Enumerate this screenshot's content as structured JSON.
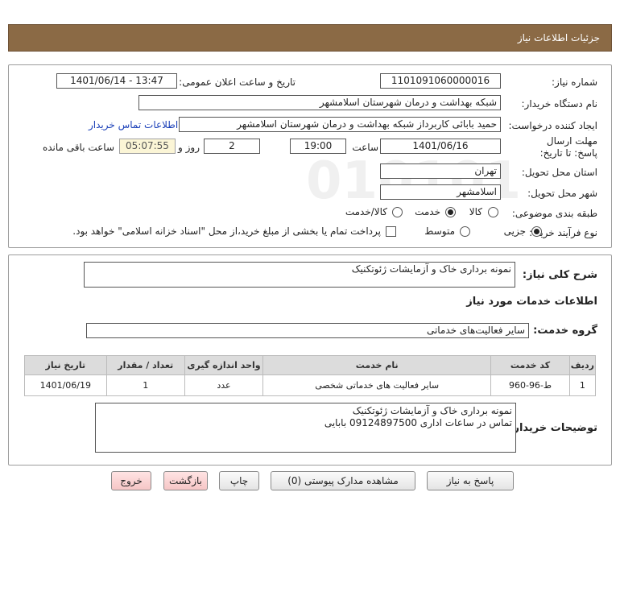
{
  "header": {
    "title": "جزئیات اطلاعات نیاز"
  },
  "form": {
    "need_number_label": "شماره نیاز:",
    "need_number": "1101091060000016",
    "announce_label": "تاریخ و ساعت اعلان عمومی:",
    "announce_value": "1401/06/14 - 13:47",
    "buyer_org_label": "نام دستگاه خریدار:",
    "buyer_org": "شبکه بهداشت و درمان شهرستان اسلامشهر",
    "creator_label": "ایجاد کننده درخواست:",
    "creator": "حمید بابائی کاربرداز شبکه بهداشت و درمان شهرستان اسلامشهر",
    "contact_link": "اطلاعات تماس خریدار",
    "deadline_label": "مهلت ارسال پاسخ: تا تاریخ:",
    "deadline_date": "1401/06/16",
    "time_label": "ساعت",
    "deadline_time": "19:00",
    "days_value": "2",
    "days_label": "روز و",
    "remaining_time": "05:07:55",
    "remaining_label": "ساعت باقی مانده",
    "province_label": "استان محل تحویل:",
    "province": "تهران",
    "city_label": "شهر محل تحویل:",
    "city": "اسلامشهر",
    "category_label": "طبقه بندی موضوعی:",
    "category_options": [
      "کالا",
      "خدمت",
      "کالا/خدمت"
    ],
    "category_selected": "خدمت",
    "purchase_type_label": "نوع فرآیند خرید :",
    "purchase_options": [
      "جزیی",
      "متوسط"
    ],
    "purchase_selected": "جزیی",
    "treasury_text": "پرداخت تمام یا بخشی از مبلغ خرید،از محل \"اسناد خزانه اسلامی\" خواهد بود."
  },
  "details": {
    "summary_label": "شرح کلی نیاز:",
    "summary": "نمونه برداری خاک و آزمایشات ژئوتکنیک",
    "services_heading": "اطلاعات خدمات مورد نیاز",
    "service_group_label": "گروه خدمت:",
    "service_group": "سایر فعالیت‌های خدماتی",
    "table": {
      "headers": [
        "ردیف",
        "کد خدمت",
        "نام خدمت",
        "واحد اندازه گیری",
        "تعداد / مقدار",
        "تاریخ نیاز"
      ],
      "rows": [
        [
          "1",
          "ط-96-960",
          "سایر فعالیت های خدماتی شخصی",
          "عدد",
          "1",
          "1401/06/19"
        ]
      ]
    },
    "buyer_notes_label": "توضیحات خریدار:",
    "buyer_notes_line1": "نمونه برداری خاک و آزمایشات ژئوتکنیک",
    "buyer_notes_line2": "تماس در ساعات اداری 09124897500  بابایی"
  },
  "buttons": {
    "reply": "پاسخ به نیاز",
    "attachments": "مشاهده مدارک پیوستی (0)",
    "print": "چاپ",
    "back": "بازگشت",
    "exit": "خروج"
  },
  "colors": {
    "header_bg": "#8b6a45",
    "link": "#1a3fb8",
    "remaining_bg": "#fbf5d6",
    "danger_btn": "#f6c6c6"
  }
}
